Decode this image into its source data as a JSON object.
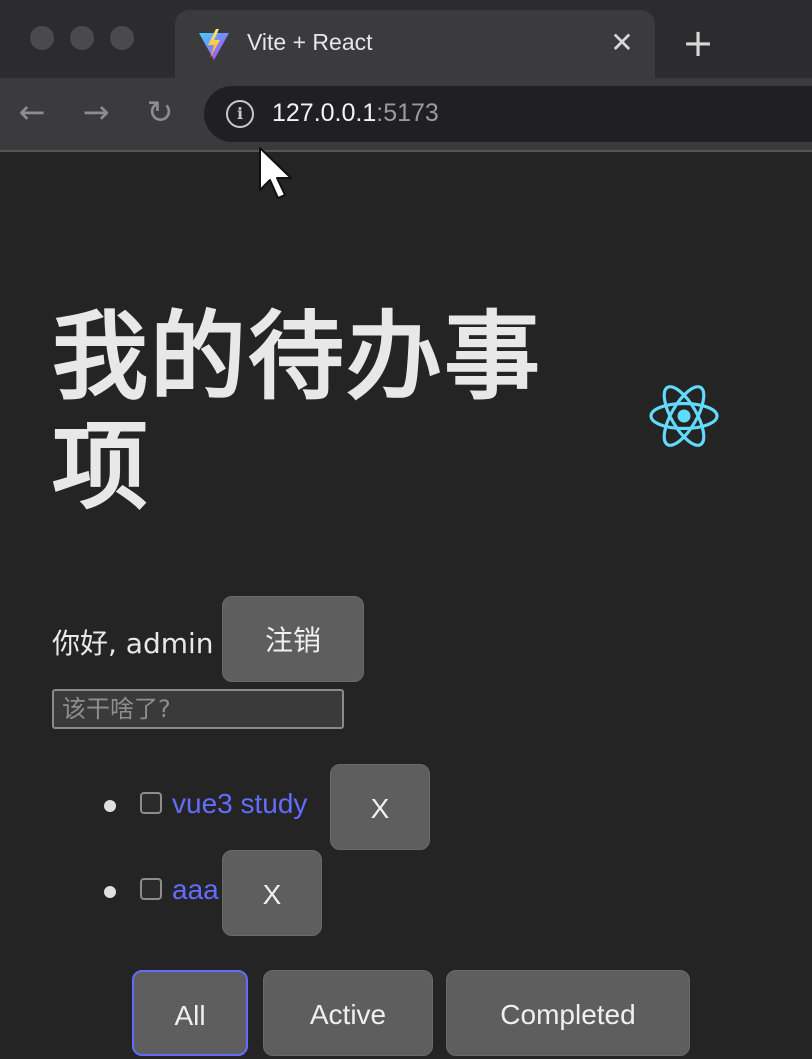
{
  "browser": {
    "tab_title": "Vite + React",
    "tab_close": "✕",
    "new_tab": "+",
    "nav": {
      "back": "←",
      "forward": "→",
      "reload": "↻"
    },
    "url_host": "127.0.0.1",
    "url_port": ":5173",
    "info_icon": "i"
  },
  "app": {
    "heading": "我的待办事项",
    "greeting": "你好, admin",
    "logout_label": "注销",
    "input_placeholder": "该干啥了?",
    "todos": [
      {
        "text": "vue3 study",
        "delete_label": "X",
        "checked": false
      },
      {
        "text": "aaa",
        "delete_label": "X",
        "checked": false
      }
    ],
    "filters": {
      "all": "All",
      "active": "Active",
      "completed": "Completed",
      "selected": "All"
    }
  },
  "colors": {
    "accent": "#646cff",
    "react": "#61dafb",
    "background": "#242424"
  }
}
